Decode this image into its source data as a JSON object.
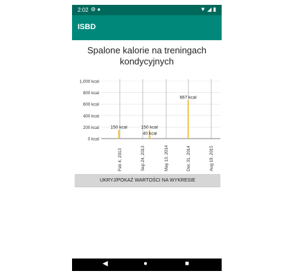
{
  "status_bar": {
    "time": "2:02",
    "left_icons": [
      "gear-icon",
      "shield-icon"
    ],
    "right_icons": [
      "wifi-icon",
      "signal-icon",
      "battery-icon"
    ]
  },
  "app_bar": {
    "title": "ISBD"
  },
  "page": {
    "heading": "Spalone kalorie na treningach kondycyjnych"
  },
  "toggle_button": {
    "label": "UKRYJ/POKAŻ WARTOŚCI NA WYKRESIE"
  },
  "navigation": {
    "icons": [
      "back-icon",
      "home-icon",
      "recents-icon"
    ]
  },
  "colors": {
    "status_bar": "#00695c",
    "app_bar": "#00897b",
    "bars": "#f2c14e",
    "button": "#d6d6d6"
  },
  "chart_data": {
    "type": "bar",
    "y_ticks": [
      "1,000 kcal",
      "800 kcal",
      "600 kcal",
      "400 kcal",
      "200 kcal",
      "0 kcal"
    ],
    "y_tick_values": [
      1000,
      800,
      600,
      400,
      200,
      0
    ],
    "x_ticks": [
      "Feb 4, 2013",
      "Sep 24, 2013",
      "May 13, 2014",
      "Dec 31, 2014",
      "Aug 19, 2015"
    ],
    "ylim": [
      0,
      1000
    ],
    "points": [
      {
        "date": "2013-01-25",
        "value": 150,
        "label": "150 kcal"
      },
      {
        "date": "2013-12-01",
        "value": 150,
        "label": "150 kcal"
      },
      {
        "date": "2013-12-05",
        "value": 40,
        "label": "40 kcal"
      },
      {
        "date": "2014-12-28",
        "value": 667,
        "label": "667 kcal"
      }
    ]
  }
}
